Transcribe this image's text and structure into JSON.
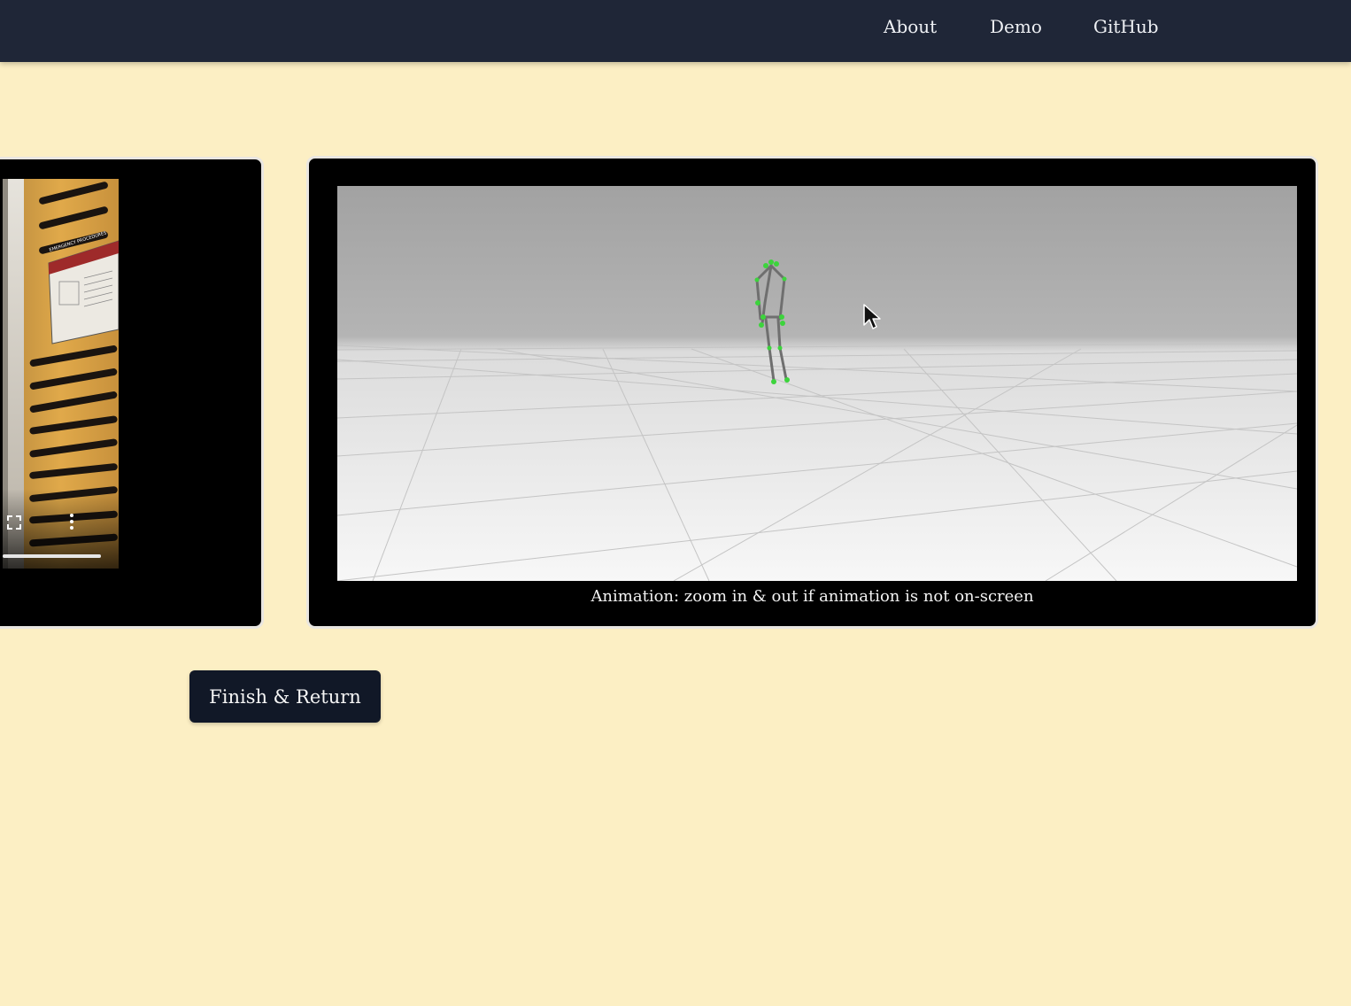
{
  "nav": {
    "links": [
      {
        "label": "About"
      },
      {
        "label": "Demo"
      },
      {
        "label": "GitHub"
      }
    ]
  },
  "video_panel": {
    "sign_text": "EMERGENCY PROCEDURES",
    "controls": {
      "fullscreen_icon": "fullscreen-icon",
      "more_icon": "more-vertical-icon"
    },
    "progress_fraction": 1.0
  },
  "animation_panel": {
    "caption": "Animation: zoom in & out if animation is not on-screen"
  },
  "finish_button": {
    "label": "Finish & Return"
  }
}
